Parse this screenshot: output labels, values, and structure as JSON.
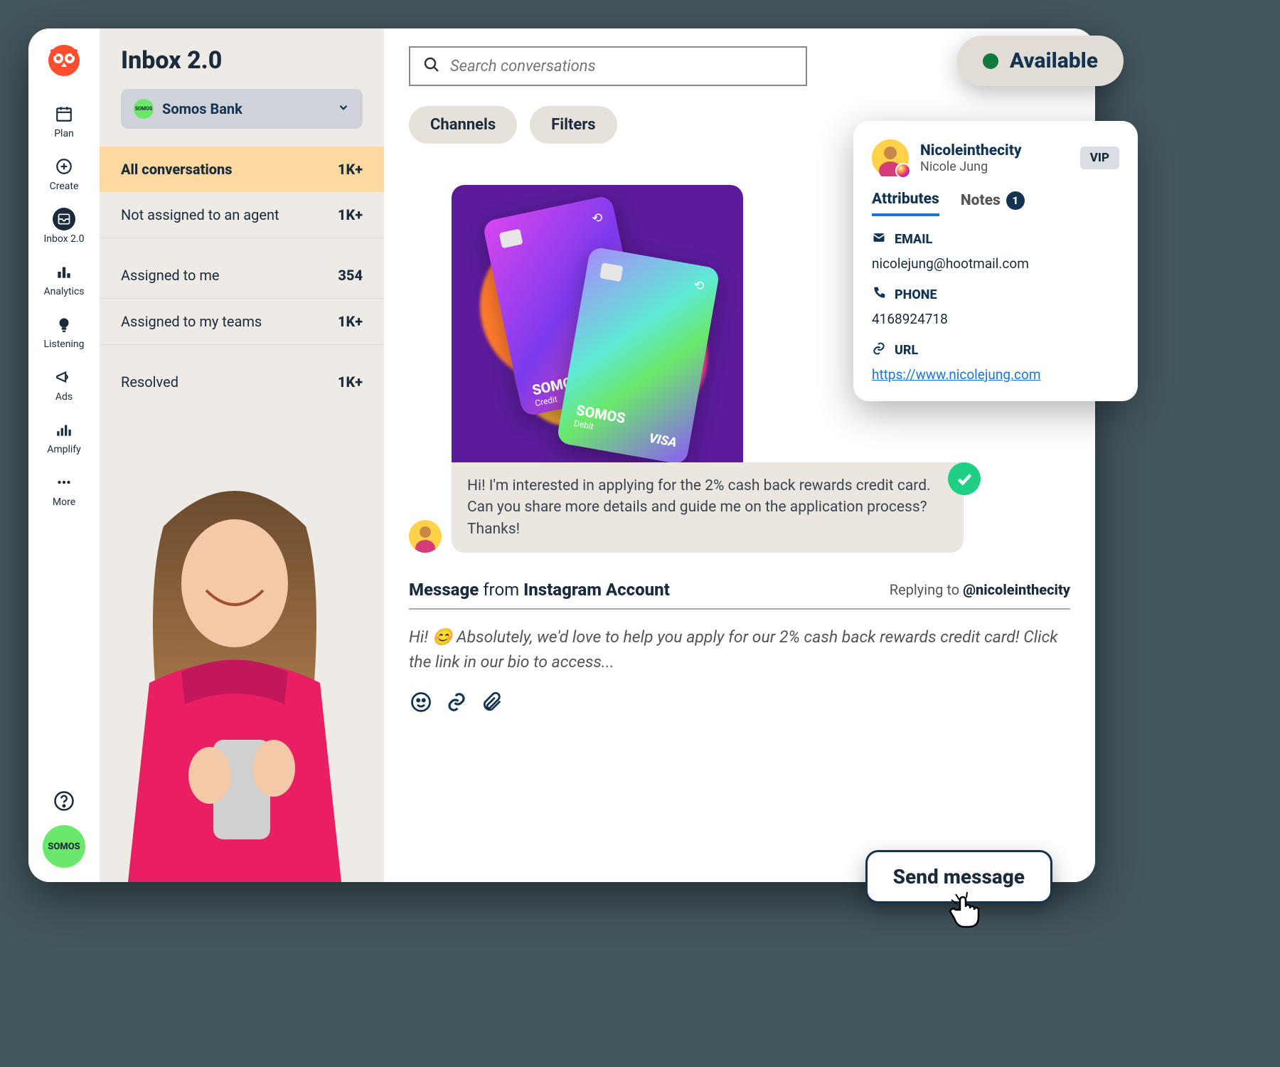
{
  "nav": {
    "items": [
      {
        "label": "Plan"
      },
      {
        "label": "Create"
      },
      {
        "label": "Inbox 2.0"
      },
      {
        "label": "Analytics"
      },
      {
        "label": "Listening"
      },
      {
        "label": "Ads"
      },
      {
        "label": "Amplify"
      },
      {
        "label": "More"
      }
    ]
  },
  "brand_badge": "SOMOS",
  "inbox": {
    "title": "Inbox 2.0",
    "workspace": "Somos Bank",
    "workspace_badge": "SOMOS",
    "filters": [
      {
        "label": "All conversations",
        "count": "1K+"
      },
      {
        "label": "Not assigned to an agent",
        "count": "1K+"
      },
      {
        "label": "Assigned to me",
        "count": "354"
      },
      {
        "label": "Assigned to  my teams",
        "count": "1K+"
      },
      {
        "label": "Resolved",
        "count": "1K+"
      }
    ]
  },
  "main": {
    "search_placeholder": "Search conversations",
    "pills": {
      "channels": "Channels",
      "filters": "Filters"
    },
    "message_text": "Hi! I'm interested in applying for the 2% cash back rewards credit card. Can you share more details and guide me on the application process? Thanks!",
    "reply_header": {
      "prefix": "Message",
      "from_word": "from",
      "source": "Instagram Account",
      "replying_prefix": "Replying to",
      "replying_handle": "@nicoleinthecity"
    },
    "draft": "Hi! 😊 Absolutely, we'd love to help you apply for our 2% cash back rewards credit card! Click the link in our bio to access...",
    "card_art": {
      "brand": "SOMOS",
      "credit_label": "Credit",
      "debit_label": "Debit",
      "network": "VISA"
    }
  },
  "availability": "Available",
  "contact": {
    "handle": "Nicoleinthecity",
    "name": "Nicole Jung",
    "vip": "VIP",
    "tabs": {
      "attributes": "Attributes",
      "notes": "Notes",
      "notes_count": "1"
    },
    "email_label": "EMAIL",
    "email": "nicolejung@hootmail.com",
    "phone_label": "PHONE",
    "phone": "4168924718",
    "url_label": "URL",
    "url": "https://www.nicolejung.com"
  },
  "send_button": "Send message"
}
